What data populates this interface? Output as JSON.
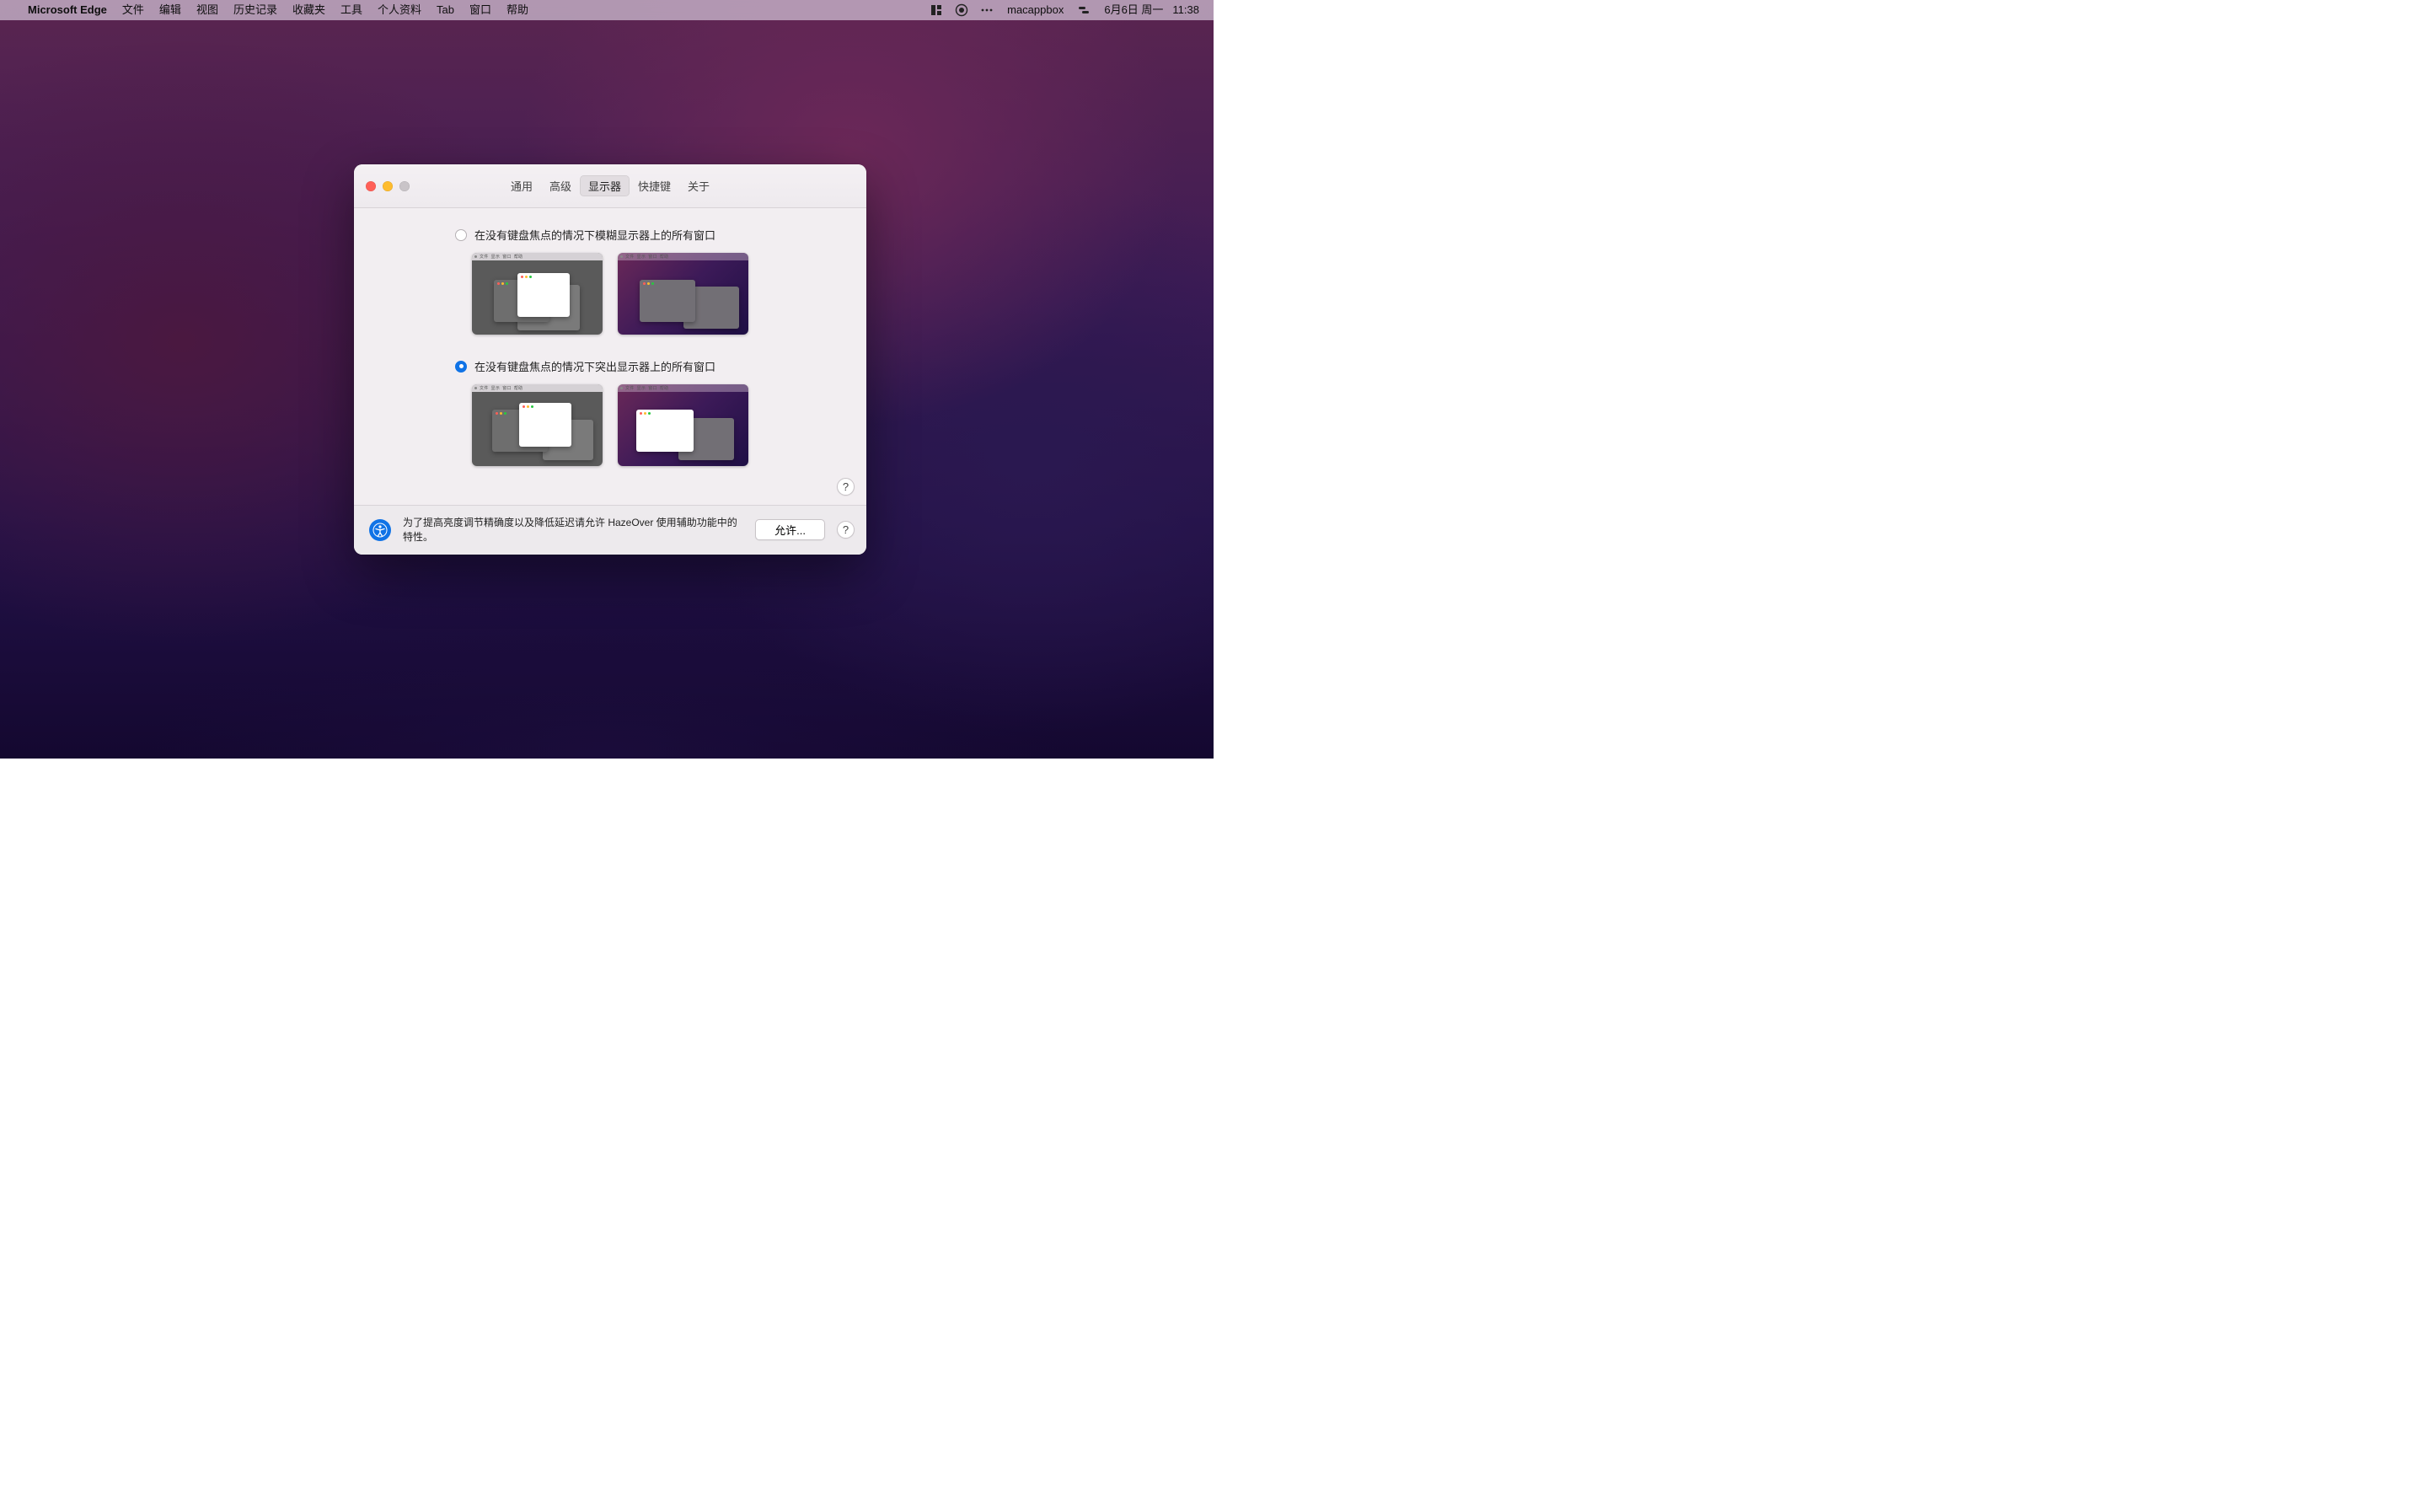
{
  "menubar": {
    "app_name": "Microsoft Edge",
    "items": [
      "文件",
      "编辑",
      "视图",
      "历史记录",
      "收藏夹",
      "工具",
      "个人资料",
      "Tab",
      "窗口",
      "帮助"
    ],
    "user": "macappbox",
    "date": "6月6日 周一",
    "time": "11:38"
  },
  "window": {
    "tabs": [
      "通用",
      "高级",
      "显示器",
      "快捷键",
      "关于"
    ],
    "selected_tab_index": 2,
    "option1_label": "在没有键盘焦点的情况下模糊显示器上的所有窗口",
    "option2_label": "在没有键盘焦点的情况下突出显示器上的所有窗口",
    "selected_option": 2,
    "help_glyph": "?",
    "footer_text": "为了提高亮度调节精确度以及降低延迟请允许 HazeOver 使用辅助功能中的特性。",
    "allow_label": "允许...",
    "preview_menubar_items": [
      "文件",
      "显示",
      "窗口",
      "帮助"
    ]
  }
}
